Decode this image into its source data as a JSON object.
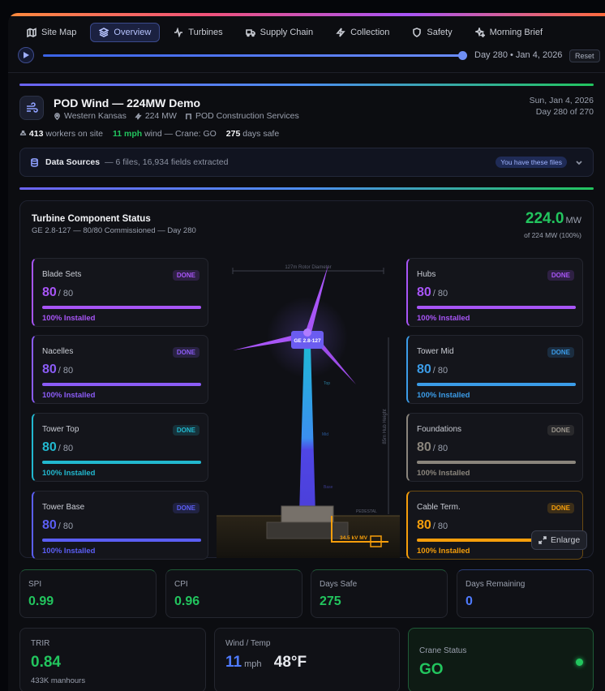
{
  "tabs": [
    {
      "label": "Site Map",
      "icon": "map-icon"
    },
    {
      "label": "Overview",
      "icon": "layers-icon",
      "active": true
    },
    {
      "label": "Turbines",
      "icon": "activity-icon"
    },
    {
      "label": "Supply Chain",
      "icon": "truck-icon"
    },
    {
      "label": "Collection",
      "icon": "bolt-icon"
    },
    {
      "label": "Safety",
      "icon": "shield-icon"
    },
    {
      "label": "Morning Brief",
      "icon": "sparkle-icon"
    }
  ],
  "timeline": {
    "day_label": "Day 280 • Jan 4, 2026",
    "reset_label": "Reset",
    "progress": 1.0
  },
  "site": {
    "title": "POD Wind — 224MW Demo",
    "location": "Western Kansas",
    "capacity": "224 MW",
    "contractor": "POD Construction Services",
    "date": "Sun, Jan 4, 2026",
    "day": "Day 280 of 270",
    "workers_count": "413",
    "workers_label": "workers on site",
    "wind_value": "11 mph",
    "wind_label": "wind — Crane: GO",
    "days_safe_count": "275",
    "days_safe_label": "days safe"
  },
  "data_sources": {
    "title": "Data Sources",
    "summary": "— 6 files, 16,934 fields extracted",
    "badge": "You have these files"
  },
  "turbine_panel": {
    "title": "Turbine Component Status",
    "subtitle": "GE 2.8-127 — 80/80 Commissioned — Day 280",
    "mw_value": "224.0",
    "mw_unit": "MW",
    "mw_of": "of 224 MW (100%)",
    "enlarge_label": "Enlarge",
    "diagram": {
      "rotor_label": "127m Rotor Diameter",
      "nacelle_label": "GE 2.8-127",
      "hub_height_label": "85m Hub Height",
      "top_label": "Top",
      "mid_label": "Mid",
      "base_label": "Base",
      "pedestal_label": "PEDESTAL",
      "cable_label": "34.5 kV MV"
    },
    "components": [
      {
        "name": "Blade Sets",
        "status": "DONE",
        "installed": "80",
        "total": "/ 80",
        "pct_text": "100% Installed",
        "progress": 1.0,
        "color": "#a855f7"
      },
      {
        "name": "Nacelles",
        "status": "DONE",
        "installed": "80",
        "total": "/ 80",
        "pct_text": "100% Installed",
        "progress": 1.0,
        "color": "#8b5cf6"
      },
      {
        "name": "Tower Top",
        "status": "DONE",
        "installed": "80",
        "total": "/ 80",
        "pct_text": "100% Installed",
        "progress": 1.0,
        "color": "#22b8cf"
      },
      {
        "name": "Tower Base",
        "status": "DONE",
        "installed": "80",
        "total": "/ 80",
        "pct_text": "100% Installed",
        "progress": 1.0,
        "color": "#5b5ef4"
      },
      {
        "name": "Hubs",
        "status": "DONE",
        "installed": "80",
        "total": "/ 80",
        "pct_text": "100% Installed",
        "progress": 1.0,
        "color": "#a855f7"
      },
      {
        "name": "Tower Mid",
        "status": "DONE",
        "installed": "80",
        "total": "/ 80",
        "pct_text": "100% Installed",
        "progress": 1.0,
        "color": "#3b9ce8"
      },
      {
        "name": "Foundations",
        "status": "DONE",
        "installed": "80",
        "total": "/ 80",
        "pct_text": "100% Installed",
        "progress": 1.0,
        "color": "#8a857c"
      },
      {
        "name": "Cable Term.",
        "status": "DONE",
        "installed": "80",
        "total": "/ 80",
        "pct_text": "100% Installed",
        "progress": 1.0,
        "color": "#f59e0b"
      }
    ]
  },
  "metrics": [
    {
      "label": "SPI",
      "value": "0.99",
      "color": "#22c55e",
      "accent": "#1f5a37"
    },
    {
      "label": "CPI",
      "value": "0.96",
      "color": "#22c55e",
      "accent": "#1f5a37"
    },
    {
      "label": "Days Safe",
      "value": "275",
      "color": "#22c55e",
      "accent": "#1f5a37"
    },
    {
      "label": "Days Remaining",
      "value": "0",
      "color": "#4f7bff",
      "accent": "#2c3f7a"
    }
  ],
  "bottom": {
    "trir": {
      "label": "TRIR",
      "value": "0.84",
      "sub": "433K manhours"
    },
    "wind": {
      "label": "Wind / Temp",
      "wind_value": "11",
      "wind_unit": "mph",
      "temp": "48°F"
    },
    "crane": {
      "label": "Crane Status",
      "value": "GO"
    }
  }
}
